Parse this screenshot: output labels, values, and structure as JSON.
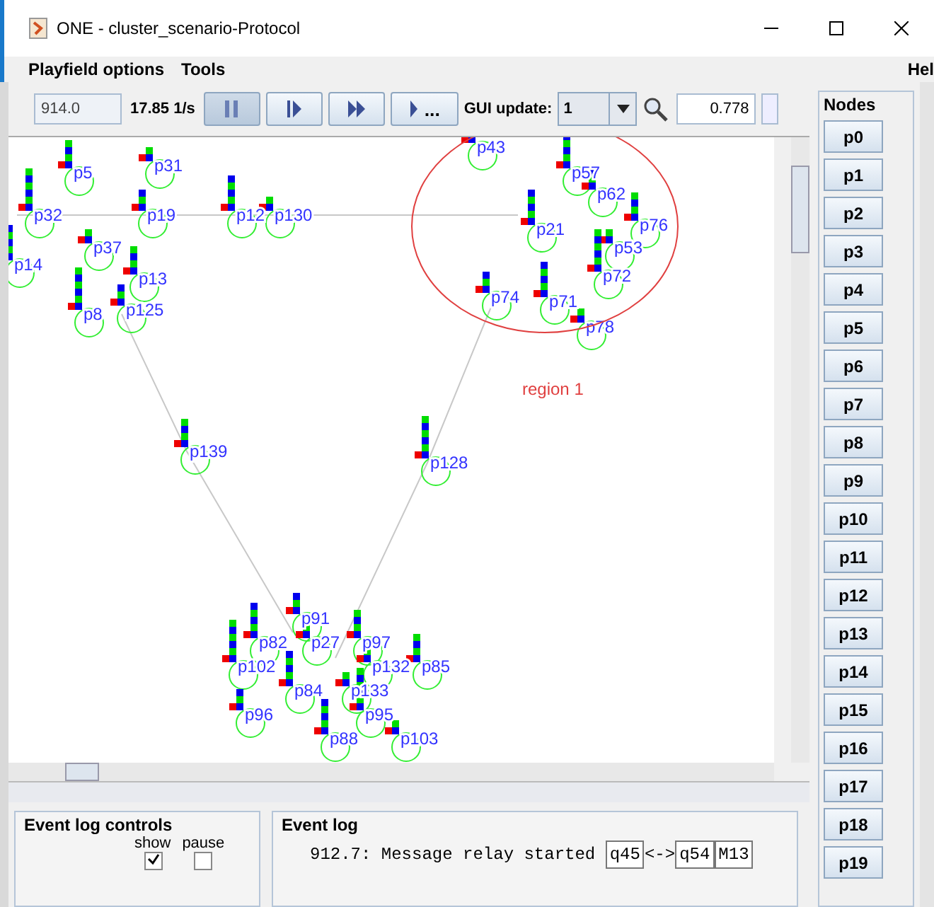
{
  "window": {
    "title": "ONE - cluster_scenario-Protocol"
  },
  "menu": [
    "Playfield options",
    "Tools",
    "Hel"
  ],
  "toolbar": {
    "time": "914.0",
    "speed": "17.85 1/s",
    "run_more_label": "...",
    "gui_update_label": "GUI update:",
    "gui_update_value": "1",
    "zoom": "0.778",
    "paused": true
  },
  "playfield": {
    "region_label": "region 1",
    "nodes": [
      {
        "label": "p31"
      },
      {
        "label": "p5"
      },
      {
        "label": "p32"
      },
      {
        "label": "p19"
      },
      {
        "label": "p14"
      },
      {
        "label": "p37"
      },
      {
        "label": "p13"
      },
      {
        "label": "p8"
      },
      {
        "label": "p125"
      },
      {
        "label": "p12"
      },
      {
        "label": "p130"
      },
      {
        "label": "p43"
      },
      {
        "label": "p57"
      },
      {
        "label": "p62"
      },
      {
        "label": "p21"
      },
      {
        "label": "p53"
      },
      {
        "label": "p76"
      },
      {
        "label": "p72"
      },
      {
        "label": "p74"
      },
      {
        "label": "p71"
      },
      {
        "label": "p78"
      },
      {
        "label": "p139"
      },
      {
        "label": "p128"
      },
      {
        "label": "p91"
      },
      {
        "label": "p82"
      },
      {
        "label": "p27"
      },
      {
        "label": "p97"
      },
      {
        "label": "p102"
      },
      {
        "label": "p132"
      },
      {
        "label": "p84"
      },
      {
        "label": "p133"
      },
      {
        "label": "p85"
      },
      {
        "label": "p95"
      },
      {
        "label": "p96"
      },
      {
        "label": "p88"
      },
      {
        "label": "p103"
      }
    ]
  },
  "nodes_panel": {
    "title": "Nodes",
    "buttons": [
      "p0",
      "p1",
      "p2",
      "p3",
      "p4",
      "p5",
      "p6",
      "p7",
      "p8",
      "p9",
      "p10",
      "p11",
      "p12",
      "p13",
      "p14",
      "p15",
      "p16",
      "p17",
      "p18",
      "p19"
    ]
  },
  "event_log_controls": {
    "title": "Event log controls",
    "columns": [
      "show",
      "pause"
    ],
    "rows": [
      {
        "show": true,
        "pause": false
      }
    ]
  },
  "event_log": {
    "title": "Event log",
    "entries": [
      {
        "text": "912.7: Message relay started",
        "tags": [
          "q45",
          "<->",
          "q54",
          "M13"
        ]
      }
    ]
  }
}
